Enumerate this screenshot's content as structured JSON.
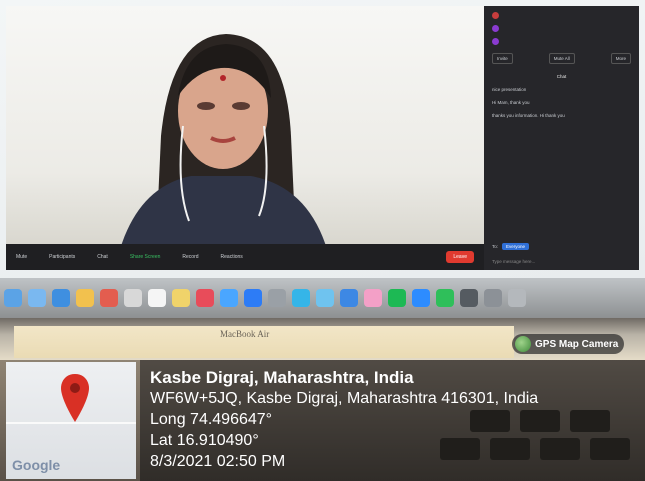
{
  "zoom": {
    "toolbar_items": [
      "Mute",
      "Participants",
      "Chat",
      "Share Screen",
      "Record",
      "Reactions"
    ],
    "end_label": "Leave",
    "panel": {
      "participants": [
        "",
        "",
        ""
      ],
      "buttons": [
        "Invite",
        "Mute All",
        "More"
      ],
      "chat_title": "Chat",
      "messages": [
        {
          "who": "",
          "text": ""
        },
        {
          "who": "",
          "text": "nice presentation"
        },
        {
          "who": "",
          "text": "Hi Mam, thank you"
        },
        {
          "who": "",
          "text": "thanks you information. Hi thank you"
        }
      ],
      "to_label": "To:",
      "to_value": "Everyone",
      "input_placeholder": "Type message here..."
    }
  },
  "laptop": {
    "brand": "MacBook Air"
  },
  "gps": {
    "camera_label": "GPS Map Camera",
    "place": "Kasbe Digraj, Maharashtra, India",
    "address": "WF6W+5JQ, Kasbe Digraj, Maharashtra 416301, India",
    "longitude": "Long 74.496647°",
    "latitude": "Lat 16.910490°",
    "datetime": "8/3/2021 02:50 PM",
    "map_logo": "Google"
  },
  "colors": {
    "zoom_dark": "#1f1f22",
    "end_button": "#e03a2f",
    "pin_red": "#d93025"
  }
}
